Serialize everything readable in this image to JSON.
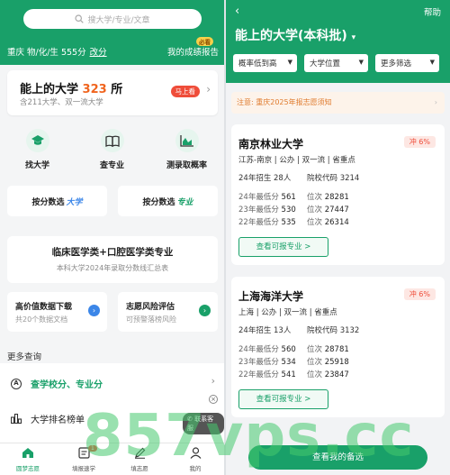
{
  "left": {
    "search_placeholder": "搜大学/专业/文章",
    "profile": {
      "info": "重庆 物/化/生 555分",
      "change_label": "改分",
      "report_label": "我的成绩报告",
      "must_badge": "必看"
    },
    "main_card": {
      "title_prefix": "能上的大学 ",
      "count": "323",
      "title_suffix": " 所",
      "subtitle": "含211大学、双一流大学",
      "action": "马上看"
    },
    "icons": [
      {
        "label": "找大学",
        "icon": "graduation-cap-icon",
        "color": "#19a069"
      },
      {
        "label": "查专业",
        "icon": "book-icon",
        "color": "#19a069"
      },
      {
        "label": "测录取概率",
        "icon": "chart-icon",
        "color": "#19a069"
      }
    ],
    "score_buttons": [
      {
        "label": "按分数选",
        "keyword": "大学"
      },
      {
        "label": "按分数选",
        "keyword": "专业"
      }
    ],
    "banner": {
      "title": "临床医学类+口腔医学类专业",
      "subtitle": "本科大学2024年录取分数线汇总表"
    },
    "tiles": [
      {
        "title": "高价值数据下载",
        "sub": "共20个数据文档",
        "color": "#3b86e8"
      },
      {
        "title": "志愿风险评估",
        "sub": "可预警落榜风险",
        "color": "#19a069"
      }
    ],
    "more_title": "更多查询",
    "list": [
      {
        "label": "查学校分、专业分"
      },
      {
        "label": "大学排名榜单"
      }
    ],
    "contact_label": "联系客服",
    "tabs": [
      {
        "label": "圆梦志愿",
        "icon": "home-icon",
        "active": true
      },
      {
        "label": "填报速学",
        "icon": "document-icon",
        "badge": "1"
      },
      {
        "label": "填志愿",
        "icon": "pen-icon"
      },
      {
        "label": "我的",
        "icon": "user-icon"
      }
    ]
  },
  "right": {
    "back_icon": "chevron-left-icon",
    "help_label": "帮助",
    "title": "能上的大学(本科批)",
    "filters": [
      "概率低到高",
      "大学位置",
      "更多筛选"
    ],
    "notice": "注意: 重庆2025年报志愿须知",
    "universities": [
      {
        "name": "南京林业大学",
        "tag": "冲 6%",
        "meta": "江苏-南京 | 公办 | 双一流 | 省重点",
        "plan": "24年招生 28人",
        "code": "院校代码 3214",
        "scores": [
          {
            "year": "24年最低分",
            "score": "561",
            "rank_label": "位次",
            "rank": "28281"
          },
          {
            "year": "23年最低分",
            "score": "530",
            "rank_label": "位次",
            "rank": "27447"
          },
          {
            "year": "22年最低分",
            "score": "535",
            "rank_label": "位次",
            "rank": "26314"
          }
        ],
        "button": "查看可报专业 >"
      },
      {
        "name": "上海海洋大学",
        "tag": "冲 6%",
        "meta": "上海 | 公办 | 双一流 | 省重点",
        "plan": "24年招生 13人",
        "code": "院校代码 3132",
        "scores": [
          {
            "year": "24年最低分",
            "score": "560",
            "rank_label": "位次",
            "rank": "28781"
          },
          {
            "year": "23年最低分",
            "score": "534",
            "rank_label": "位次",
            "rank": "25918"
          },
          {
            "year": "22年最低分",
            "score": "541",
            "rank_label": "位次",
            "rank": "23847"
          }
        ],
        "button": "查看可报专业 >"
      }
    ],
    "cta": "查看我的备选"
  },
  "watermark": "857vps.cc",
  "colors": {
    "brand_green": "#19a069",
    "accent_orange": "#f0641e",
    "alert_red": "#ef4d3a"
  }
}
